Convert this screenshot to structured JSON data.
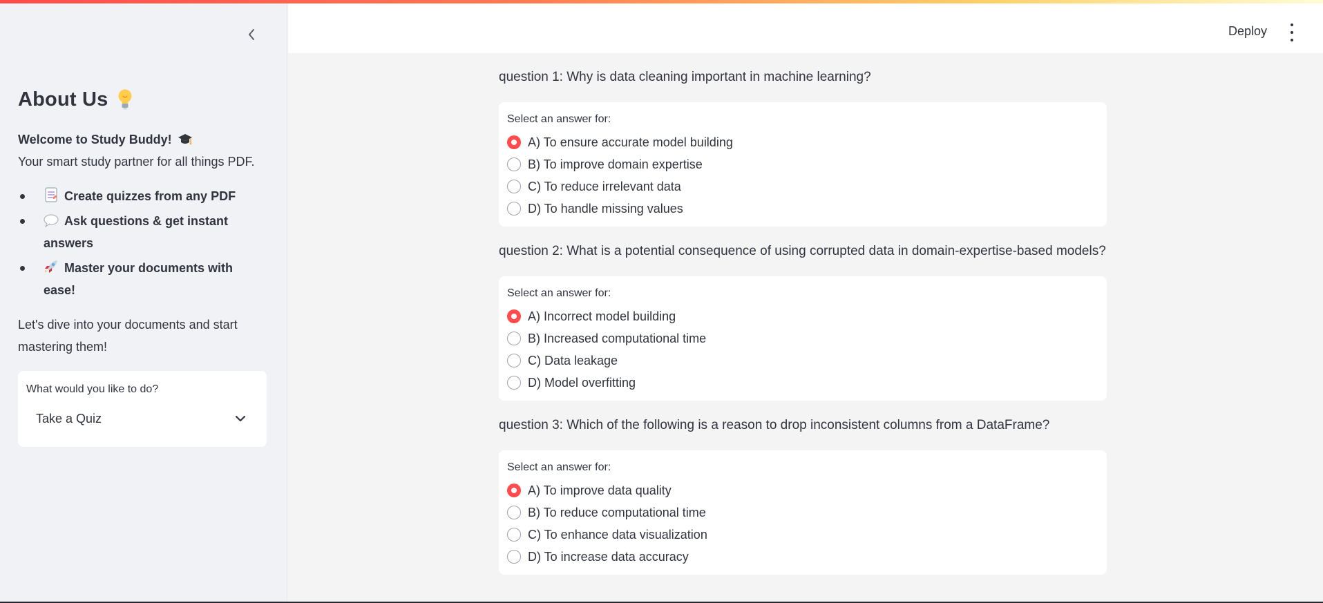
{
  "header": {
    "deploy_label": "Deploy"
  },
  "sidebar": {
    "title": "About Us",
    "welcome": "Welcome to Study Buddy!",
    "tagline": "Your smart study partner for all things PDF.",
    "features": [
      {
        "icon": "memo-icon",
        "label": "Create quizzes from any PDF"
      },
      {
        "icon": "speech-bubble-icon",
        "label": "Ask questions & get instant answers"
      },
      {
        "icon": "rocket-icon",
        "label": "Master your documents with ease!"
      }
    ],
    "dive_text": "Let's dive into your documents and start mastering them!",
    "select": {
      "label": "What would you like to do?",
      "value": "Take a Quiz"
    }
  },
  "quiz": {
    "questions": [
      {
        "text": "question 1: Why is data cleaning important in machine learning?",
        "prompt": "Select an answer for:",
        "options": [
          "A) To ensure accurate model building",
          "B) To improve domain expertise",
          "C) To reduce irrelevant data",
          "D) To handle missing values"
        ],
        "selected": 0
      },
      {
        "text": "question 2: What is a potential consequence of using corrupted data in domain-expertise-based models?",
        "prompt": "Select an answer for:",
        "options": [
          "A) Incorrect model building",
          "B) Increased computational time",
          "C) Data leakage",
          "D) Model overfitting"
        ],
        "selected": 0
      },
      {
        "text": "question 3: Which of the following is a reason to drop inconsistent columns from a DataFrame?",
        "prompt": "Select an answer for:",
        "options": [
          "A) To improve data quality",
          "B) To reduce computational time",
          "C) To enhance data visualization",
          "D) To increase data accuracy"
        ],
        "selected": 0
      }
    ]
  },
  "colors": {
    "accent": "#ff4b4b",
    "sidebar_bg": "#f0f2f6",
    "main_bg": "#f4f4f4",
    "text": "#31333f"
  }
}
